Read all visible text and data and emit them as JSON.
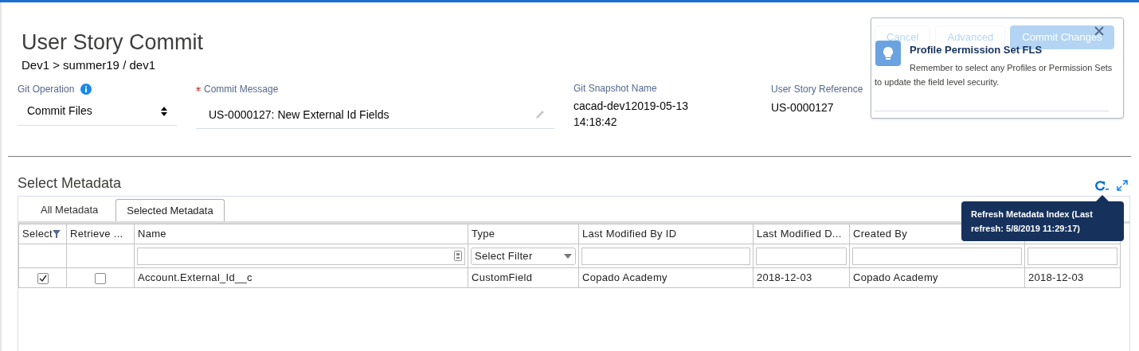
{
  "header": {
    "title": "User Story Commit",
    "breadcrumb": "Dev1 > summer19 / dev1"
  },
  "actions": [
    {
      "label": "Cancel",
      "kind": "neutral"
    },
    {
      "label": "Advanced",
      "kind": "neutral"
    },
    {
      "label": "Commit Changes",
      "kind": "brand"
    }
  ],
  "fields": [
    {
      "kind": "select",
      "label": "Git Operation",
      "info": true,
      "value": "Commit Files"
    },
    {
      "kind": "input",
      "label": "Commit Message",
      "required": true,
      "value": "US-0000127: New External Id Fields"
    },
    {
      "kind": "text",
      "label": "Git Snapshot Name",
      "value": "cacad-dev12019-05-13 14:18:42"
    },
    {
      "kind": "text",
      "label": "User Story Reference",
      "value": "US-0000127"
    }
  ],
  "popover": {
    "title": "Profile Permission Set FLS",
    "body": "Remember to select any Profiles or Permission Sets to update the field level security."
  },
  "metadata": {
    "title": "Select Metadata",
    "tabs": [
      {
        "label": "All Metadata",
        "selected": false
      },
      {
        "label": "Selected Metadata",
        "selected": true
      }
    ],
    "tooltip": "Refresh Metadata Index (Last refresh: 5/8/2019 11:29:17)",
    "columns": [
      {
        "label": "Select",
        "kind": "none",
        "funnel": true
      },
      {
        "label": "Retrieve ...",
        "kind": "none"
      },
      {
        "label": "Name",
        "kind": "search"
      },
      {
        "label": "Type",
        "kind": "select",
        "placeholder": "Select Filter"
      },
      {
        "label": "Last Modified By ID",
        "kind": "text"
      },
      {
        "label": "Last Modified D...",
        "kind": "text"
      },
      {
        "label": "Created By",
        "kind": "text"
      },
      {
        "kind": "text"
      }
    ],
    "rows": [
      {
        "cells": [
          {
            "kind": "checkbox",
            "checked": true
          },
          {
            "kind": "checkbox",
            "checked": false
          },
          {
            "kind": "text",
            "text": "Account.External_Id__c"
          },
          {
            "kind": "text",
            "text": "CustomField"
          },
          {
            "kind": "text",
            "text": "Copado Academy"
          },
          {
            "kind": "text",
            "text": "2018-12-03"
          },
          {
            "kind": "text",
            "text": "Copado Academy"
          },
          {
            "kind": "text",
            "text": "2018-12-03"
          }
        ]
      }
    ]
  }
}
